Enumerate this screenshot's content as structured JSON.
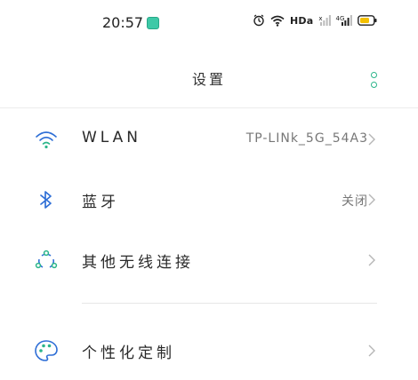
{
  "status_bar": {
    "time": "20:57",
    "hd_label": "HDa",
    "sig1_tag": "x",
    "sig2_tag": "4G",
    "icons": [
      "app-notification-icon",
      "alarm-icon",
      "wifi-icon",
      "signal-icon",
      "battery-icon"
    ]
  },
  "header": {
    "title": "设置",
    "more_icon": "more-vertical-icon"
  },
  "settings": [
    {
      "label": "WLAN",
      "value": "TP-LINk_5G_54A3",
      "icon": "wifi-icon"
    },
    {
      "label": "蓝牙",
      "value": "关闭",
      "icon": "bluetooth-icon"
    },
    {
      "label": "其他无线连接",
      "value": "",
      "icon": "connections-icon"
    },
    {
      "label": "个性化定制",
      "value": "",
      "icon": "palette-icon"
    }
  ],
  "colors": {
    "accent": "#2bb58a",
    "battery": "#f4c000",
    "icon_blue": "#2f6fd6"
  }
}
